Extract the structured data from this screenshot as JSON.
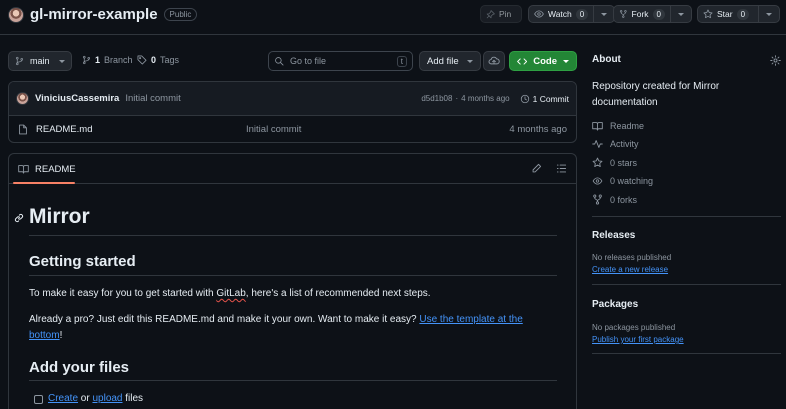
{
  "header": {
    "repo_name": "gl-mirror-example",
    "visibility": "Public",
    "pin_label": "Pin",
    "watch_label": "Watch",
    "watch_count": "0",
    "fork_label": "Fork",
    "fork_count": "0",
    "star_label": "Star",
    "star_count": "0"
  },
  "toolbar": {
    "branch": "main",
    "branches_count": "1",
    "branches_label": "Branch",
    "tags_count": "0",
    "tags_label": "Tags",
    "search_placeholder": "Go to file",
    "search_shortcut": "t",
    "add_file_label": "Add file",
    "code_label": "Code"
  },
  "commit": {
    "author": "ViniciusCassemira",
    "message": "Initial commit",
    "hash": "d5d1b08",
    "time": "4 months ago",
    "commits_label": "1 Commit"
  },
  "files": [
    {
      "name": "README.md",
      "message": "Initial commit",
      "time": "4 months ago"
    }
  ],
  "readme": {
    "tab_label": "README",
    "title": "Mirror",
    "h_getting_started": "Getting started",
    "p1_before": "To make it easy for you to get started with ",
    "p1_gitlab": "GitLab",
    "p1_after": ", here's a list of recommended next steps.",
    "p2_before": "Already a pro? Just edit this README.md and make it your own. Want to make it easy? ",
    "p2_link": "Use the template at the bottom",
    "p2_after": "!",
    "h_add_files": "Add your files",
    "task_create": "Create",
    "task_or": " or ",
    "task_upload": "upload",
    "task_files": " files"
  },
  "about": {
    "heading": "About",
    "description": "Repository created for Mirror documentation",
    "readme": "Readme",
    "activity": "Activity",
    "stars": "0 stars",
    "watching": "0 watching",
    "forks": "0 forks"
  },
  "releases": {
    "heading": "Releases",
    "none": "No releases published",
    "create": "Create a new release"
  },
  "packages": {
    "heading": "Packages",
    "none": "No packages published",
    "publish": "Publish your first package"
  }
}
